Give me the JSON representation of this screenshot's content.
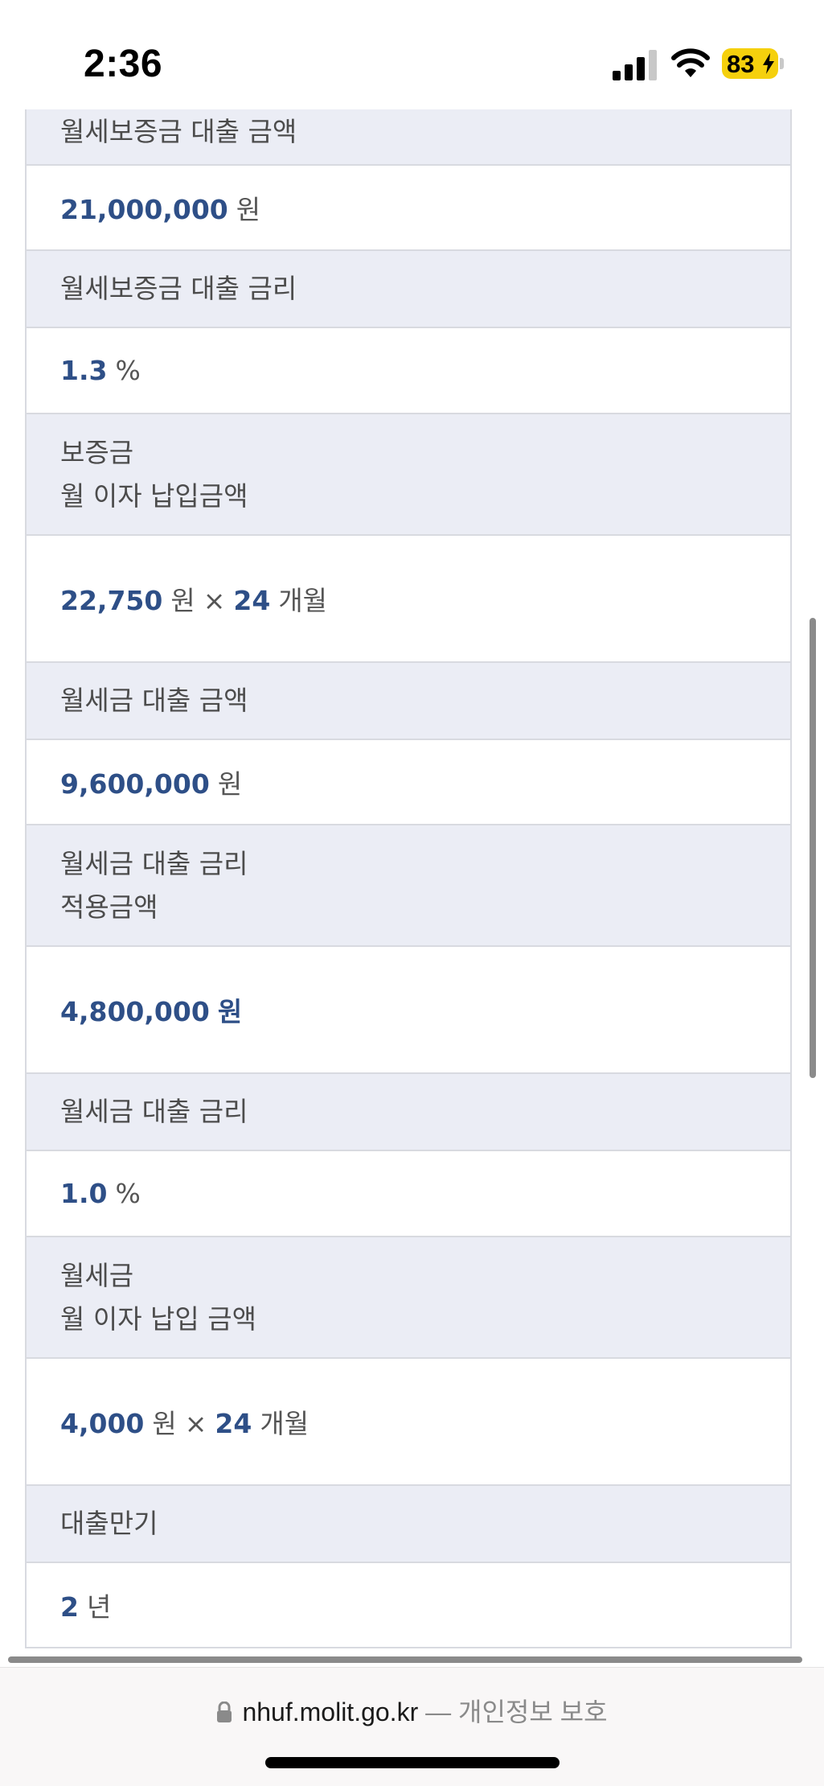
{
  "status_bar": {
    "time": "2:36",
    "battery": "83",
    "icons": [
      "signal-icon",
      "wifi-icon",
      "battery-charging-icon"
    ]
  },
  "rows": {
    "r1": {
      "label": "월세보증금 대출 금액"
    },
    "r2": {
      "num": "21,000,000",
      "unit": "원"
    },
    "r3": {
      "label": "월세보증금 대출 금리"
    },
    "r4": {
      "num": "1.3",
      "unit": "%"
    },
    "r5": {
      "line1": "보증금",
      "line2": "월 이자 납입금액"
    },
    "r6": {
      "num": "22,750",
      "unit": "원",
      "times": "×",
      "months": "24",
      "months_unit": "개월"
    },
    "r7": {
      "label": "월세금 대출 금액"
    },
    "r8": {
      "num": "9,600,000",
      "unit": "원"
    },
    "r9": {
      "line1": "월세금 대출 금리",
      "line2": "적용금액"
    },
    "r10": {
      "num": "4,800,000",
      "unit": "원"
    },
    "r11": {
      "label": "월세금 대출 금리"
    },
    "r12": {
      "num": "1.0",
      "unit": "%"
    },
    "r13": {
      "line1": "월세금",
      "line2": "월 이자 납입 금액"
    },
    "r14": {
      "num": "4,000",
      "unit": "원",
      "times": "×",
      "months": "24",
      "months_unit": "개월"
    },
    "r15": {
      "label": "대출만기"
    },
    "r16": {
      "num": "2",
      "unit": "년"
    }
  },
  "url_bar": {
    "domain": "nhuf.molit.go.kr",
    "separator": "—",
    "privacy": "개인정보 보호"
  },
  "colors": {
    "label_bg": "#ebedf5",
    "accent_number": "#2e4f87",
    "border": "#d8dae0",
    "battery": "#f5d00d"
  }
}
